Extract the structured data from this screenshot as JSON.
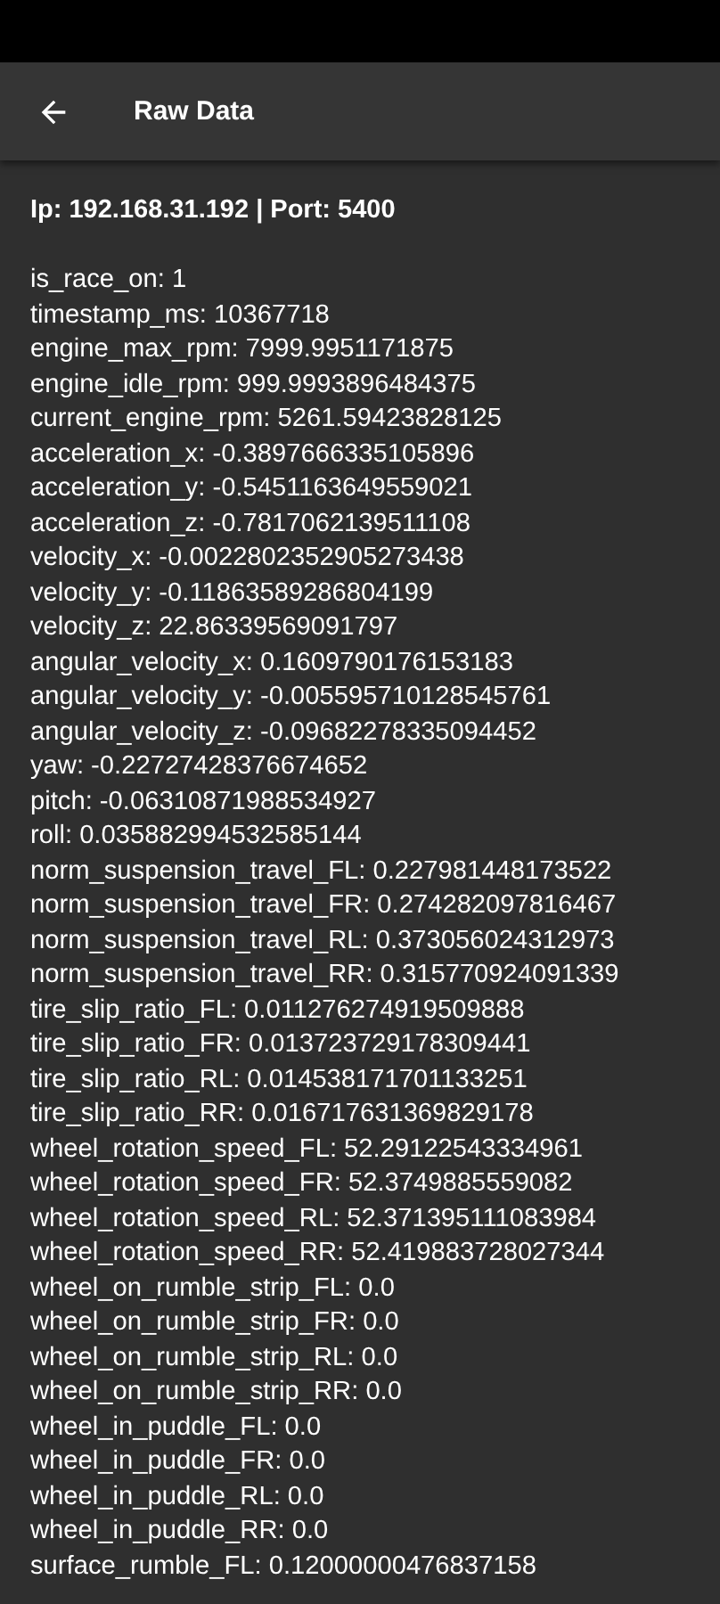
{
  "app_bar": {
    "title": "Raw Data"
  },
  "connection": "Ip: 192.168.31.192 | Port: 5400",
  "lines": [
    "is_race_on: 1",
    "timestamp_ms: 10367718",
    "engine_max_rpm: 7999.9951171875",
    "engine_idle_rpm: 999.9993896484375",
    "current_engine_rpm: 5261.59423828125",
    "acceleration_x: -0.3897666335105896",
    "acceleration_y: -0.5451163649559021",
    "acceleration_z: -0.7817062139511108",
    "velocity_x: -0.0022802352905273438",
    "velocity_y: -0.11863589286804199",
    "velocity_z: 22.86339569091797",
    "angular_velocity_x: 0.1609790176153183",
    "angular_velocity_y: -0.005595710128545761",
    "angular_velocity_z: -0.09682278335094452",
    "yaw: -0.22727428376674652",
    "pitch: -0.06310871988534927",
    "roll: 0.035882994532585144",
    "norm_suspension_travel_FL: 0.227981448173522",
    "norm_suspension_travel_FR: 0.274282097816467",
    "norm_suspension_travel_RL: 0.373056024312973",
    "norm_suspension_travel_RR: 0.315770924091339",
    "tire_slip_ratio_FL: 0.011276274919509888",
    "tire_slip_ratio_FR: 0.013723729178309441",
    "tire_slip_ratio_RL: 0.014538171701133251",
    "tire_slip_ratio_RR: 0.016717631369829178",
    "wheel_rotation_speed_FL: 52.29122543334961",
    "wheel_rotation_speed_FR: 52.3749885559082",
    "wheel_rotation_speed_RL: 52.371395111083984",
    "wheel_rotation_speed_RR: 52.419883728027344",
    "wheel_on_rumble_strip_FL: 0.0",
    "wheel_on_rumble_strip_FR: 0.0",
    "wheel_on_rumble_strip_RL: 0.0",
    "wheel_on_rumble_strip_RR: 0.0",
    "wheel_in_puddle_FL: 0.0",
    "wheel_in_puddle_FR: 0.0",
    "wheel_in_puddle_RL: 0.0",
    "wheel_in_puddle_RR: 0.0",
    "surface_rumble_FL: 0.12000000476837158"
  ]
}
